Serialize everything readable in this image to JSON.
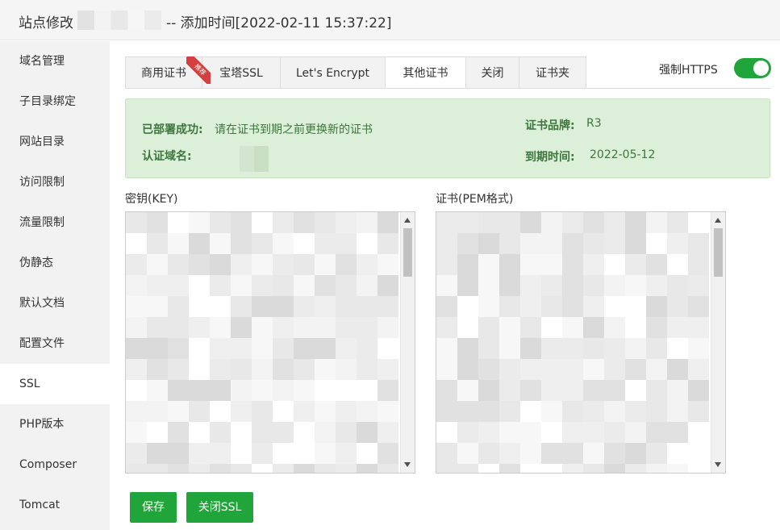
{
  "window": {
    "title_prefix": "站点修改",
    "title_suffix": "-- 添加时间[2022-02-11 15:37:22]"
  },
  "sidebar": {
    "items": [
      {
        "label": "域名管理"
      },
      {
        "label": "子目录绑定"
      },
      {
        "label": "网站目录"
      },
      {
        "label": "访问限制"
      },
      {
        "label": "流量限制"
      },
      {
        "label": "伪静态"
      },
      {
        "label": "默认文档"
      },
      {
        "label": "配置文件"
      },
      {
        "label": "SSL",
        "active": true
      },
      {
        "label": "PHP版本"
      },
      {
        "label": "Composer"
      },
      {
        "label": "Tomcat"
      }
    ]
  },
  "tabs": [
    {
      "label": "商用证书",
      "badge": "推荐"
    },
    {
      "label": "宝塔SSL"
    },
    {
      "label": "Let's Encrypt"
    },
    {
      "label": "其他证书",
      "active": true
    },
    {
      "label": "关闭"
    },
    {
      "label": "证书夹"
    }
  ],
  "force_https": {
    "label": "强制HTTPS",
    "enabled": true
  },
  "info": {
    "deployed_label": "已部署成功:",
    "deployed_text": "请在证书到期之前更换新的证书",
    "domain_label": "认证域名:",
    "brand_label": "证书品牌:",
    "brand_value": "R3",
    "expire_label": "到期时间:",
    "expire_value": "2022-05-12"
  },
  "key_label": "密钥(KEY)",
  "cert_label": "证书(PEM格式)",
  "buttons": {
    "save": "保存",
    "close_ssl": "关闭SSL"
  },
  "colors": {
    "accent": "#20a53a",
    "info_bg": "#dcefd8",
    "info_text": "#3c763d",
    "badge": "#d63f3f"
  }
}
